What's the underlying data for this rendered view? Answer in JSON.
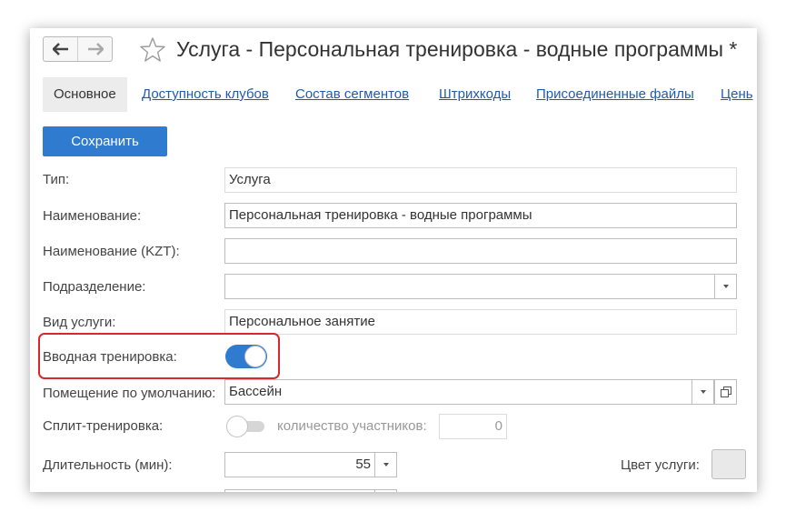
{
  "header": {
    "back_icon": "arrow-left-icon",
    "forward_icon": "arrow-right-icon",
    "favorite_icon": "star-icon",
    "title": "Услуга - Персональная тренировка - водные программы *"
  },
  "tabs": [
    {
      "label": "Основное",
      "active": true
    },
    {
      "label": "Доступность клубов"
    },
    {
      "label": "Состав сегментов"
    },
    {
      "label": "Штрихкоды"
    },
    {
      "label": "Присоединенные файлы"
    },
    {
      "label": "Цень"
    }
  ],
  "toolbar": {
    "save_label": "Сохранить"
  },
  "form": {
    "type": {
      "label": "Тип:",
      "value": "Услуга"
    },
    "name": {
      "label": "Наименование:",
      "value": "Персональная тренировка - водные программы"
    },
    "name_kzt": {
      "label": "Наименование (KZT):",
      "value": ""
    },
    "division": {
      "label": "Подразделение:",
      "value": ""
    },
    "service_kind": {
      "label": "Вид услуги:",
      "value": "Персональное занятие"
    },
    "intro_training": {
      "label": "Вводная тренировка:",
      "on": true
    },
    "default_room": {
      "label": "Помещение по умолчанию:",
      "value": "Бассейн",
      "open_icon": "open-in-window-icon"
    },
    "split_training": {
      "label": "Сплит-тренировка:",
      "on": false
    },
    "participants": {
      "label": "количество участников:",
      "value": "0"
    },
    "duration": {
      "label": "Длительность (мин):",
      "value": "55"
    },
    "service_color": {
      "label": "Цвет услуги:"
    }
  },
  "colors": {
    "accent": "#2e7bd0",
    "link": "#1f5cad",
    "highlight": "#d7282d"
  }
}
